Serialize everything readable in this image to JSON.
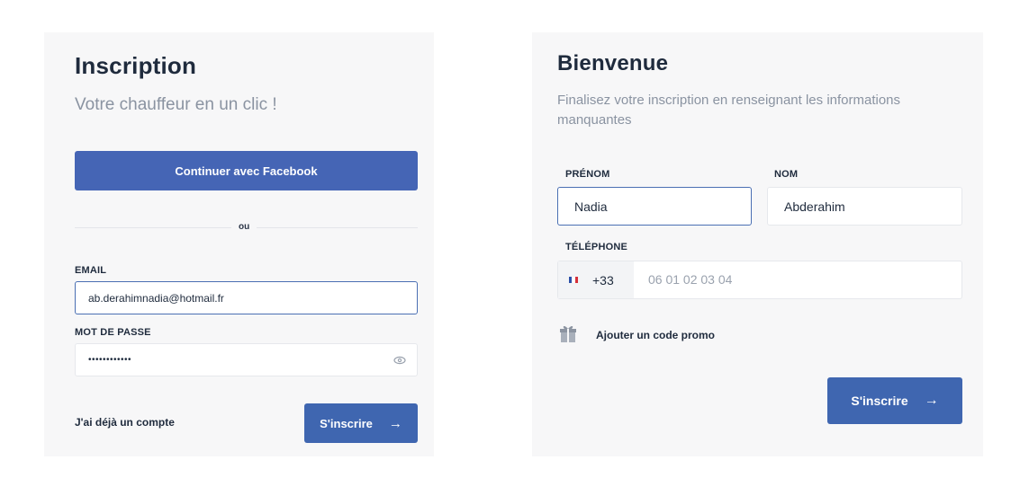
{
  "signup": {
    "title": "Inscription",
    "subtitle": "Votre chauffeur en un clic !",
    "facebook_button": "Continuer avec Facebook",
    "divider": "ou",
    "email_label": "EMAIL",
    "email_value": "ab.derahimnadia@hotmail.fr",
    "password_label": "MOT DE PASSE",
    "password_value": "••••••••••••",
    "have_account_link": "J'ai déjà un compte",
    "submit_label": "S'inscrire",
    "submit_arrow": "→"
  },
  "welcome": {
    "title": "Bienvenue",
    "subtitle": "Finalisez votre inscription en renseignant les informations manquantes",
    "firstname_label": "PRÉNOM",
    "firstname_value": "Nadia",
    "lastname_label": "NOM",
    "lastname_value": "Abderahim",
    "phone_label": "TÉLÉPHONE",
    "phone_prefix": "+33",
    "phone_placeholder": "06 01 02 03 04",
    "promo_link": "Ajouter un code promo",
    "submit_label": "S'inscrire",
    "submit_arrow": "→"
  },
  "colors": {
    "brand_blue": "#3f66b0",
    "facebook_blue": "#4565b5",
    "panel_bg": "#f7f7f8",
    "focus_border": "#4a6fb3"
  },
  "icons": {
    "password_toggle": "eye-icon",
    "country_flag": "france-flag-icon",
    "promo": "gift-icon",
    "submit": "arrow-right-icon"
  }
}
